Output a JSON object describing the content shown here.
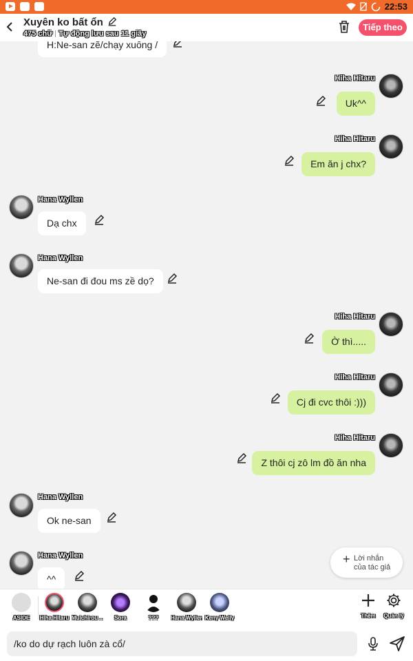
{
  "status_bar": {
    "time": "22:53",
    "icons": [
      "youtube-icon",
      "gallery-icon",
      "app-icon",
      "wifi-icon",
      "no-sim-icon",
      "battery-charging-icon"
    ]
  },
  "header": {
    "title": "Xuyên ko bất ổn",
    "word_count": "475 chữ",
    "autosave": "Tự động lưu sau 11 giây",
    "next_label": "Tiếp theo"
  },
  "messages": [
    {
      "side": "left",
      "sender": "",
      "text": "H:Ne-san zẽ/chạy xuống /"
    },
    {
      "side": "right",
      "sender": "Hiha Hitaru",
      "text": "Uk^^"
    },
    {
      "side": "right",
      "sender": "Hiha Hitaru",
      "text": "Em ăn j chx?"
    },
    {
      "side": "left",
      "sender": "Hana Wyllen",
      "text": "Dạ chx"
    },
    {
      "side": "left",
      "sender": "Hana Wyllen",
      "text": "Ne-san đi đou ms zề dọ?"
    },
    {
      "side": "right",
      "sender": "Hiha Hitaru",
      "text": "Ờ thì....."
    },
    {
      "side": "right",
      "sender": "Hiha Hitaru",
      "text": "Cj đi cvc thôi :)))"
    },
    {
      "side": "right",
      "sender": "Hiha Hitaru",
      "text": "Z thôi cj zô lm đồ ăn nha"
    },
    {
      "side": "left",
      "sender": "Hana Wyllen",
      "text": "Ok ne-san"
    },
    {
      "side": "left",
      "sender": "Hana Wyllen",
      "text": "^^"
    }
  ],
  "author_note": {
    "line1": "Lời nhắn",
    "line2": "của tác giả"
  },
  "characters": [
    {
      "name": "ASIDE"
    },
    {
      "name": "Hiha Hitaru"
    },
    {
      "name": "Muichirou ..."
    },
    {
      "name": "Sora"
    },
    {
      "name": "???"
    },
    {
      "name": "Hana Wyllen"
    },
    {
      "name": "Keny Welly"
    }
  ],
  "tools": {
    "add_label": "Thêm",
    "manage_label": "Quản lý"
  },
  "composer": {
    "value": "/ko do dự rạch luôn zà cổ/"
  },
  "colors": {
    "accent": "#f4516c",
    "status_bar": "#f06a2a",
    "right_bubble": "#d6f2a1"
  }
}
